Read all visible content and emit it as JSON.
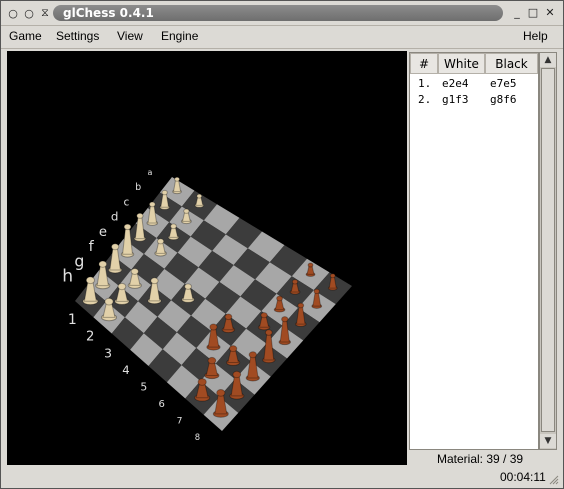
{
  "window": {
    "title": "glChess 0.4.1",
    "controls_left": [
      "○",
      "○",
      "⧖"
    ],
    "controls_right": [
      "_",
      "□",
      "✕"
    ]
  },
  "menubar": {
    "items": [
      "Game",
      "Settings",
      "View",
      "Engine"
    ],
    "help": "Help"
  },
  "board": {
    "rank_labels": [
      "1",
      "2",
      "3",
      "4",
      "5",
      "6",
      "7",
      "8"
    ],
    "file_labels": [
      "a",
      "b",
      "c",
      "d",
      "e",
      "f",
      "g",
      "h"
    ],
    "colors": {
      "background": "#000000",
      "light_square": "#a7a7a7",
      "dark_square": "#3c3c3c",
      "white_pieces": "#e2d1a9",
      "black_pieces": "#a14b22"
    }
  },
  "moves": {
    "headers": [
      "#",
      "White",
      "Black"
    ],
    "rows": [
      {
        "num": "1.",
        "white": "e2e4",
        "black": "e7e5"
      },
      {
        "num": "2.",
        "white": "g1f3",
        "black": "g8f6"
      }
    ]
  },
  "status": {
    "material": "Material: 39 / 39",
    "clock": "00:04:11"
  }
}
